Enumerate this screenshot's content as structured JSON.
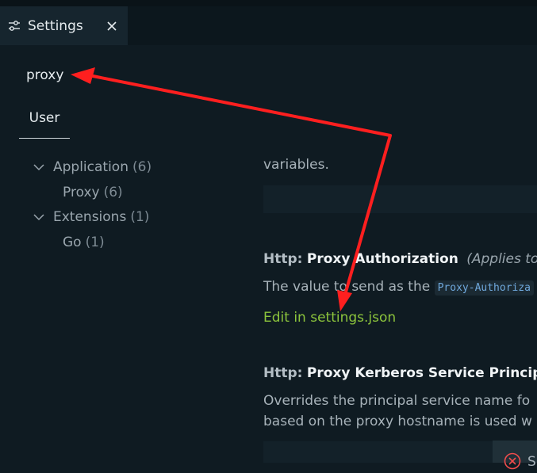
{
  "tab": {
    "title": "Settings"
  },
  "search": {
    "value": "proxy"
  },
  "scope_tab": {
    "label": "User"
  },
  "toc": [
    {
      "label": "Application",
      "count": "(6)"
    },
    {
      "label": "Proxy",
      "count": "(6)"
    },
    {
      "label": "Extensions",
      "count": "(1)"
    },
    {
      "label": "Go",
      "count": "(1)"
    }
  ],
  "settings": {
    "prev_description_tail": "variables.",
    "auth": {
      "category": "Http:",
      "name": "Proxy Authorization",
      "scope_note": "(Applies to a",
      "description_prefix": "The value to send as the",
      "code": "Proxy-Authoriza",
      "link": "Edit in settings.json"
    },
    "kerberos": {
      "category": "Http:",
      "name": "Proxy Kerberos Service Principal",
      "description_line1": "Overrides the principal service name fo",
      "description_line2": "based on the proxy hostname is used w"
    }
  },
  "toast": {
    "text": "S"
  },
  "colors": {
    "background": "#0f1b22",
    "link": "#8cc43c",
    "annotation_arrow": "#ff1f1f"
  }
}
